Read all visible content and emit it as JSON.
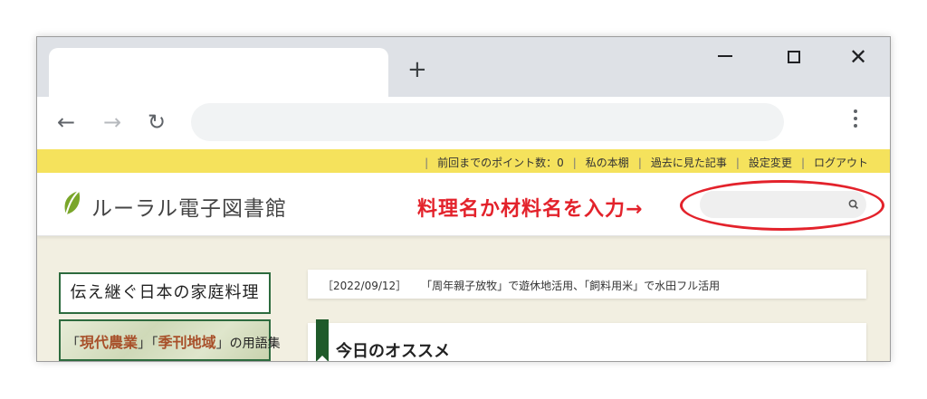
{
  "browser": {
    "new_tab": "+",
    "controls": {
      "close": "✕"
    },
    "nav": {
      "back": "←",
      "forward": "→",
      "reload": "↻"
    },
    "address": {
      "value": ""
    }
  },
  "site": {
    "topnav": {
      "points": "前回までのポイント数：0",
      "bookshelf": "私の本棚",
      "history": "過去に見た記事",
      "settings": "設定変更",
      "logout": "ログアウト"
    },
    "logo": "ルーラル電子図書館",
    "annotation": "料理名か材料名を入力→",
    "search": {
      "value": "",
      "placeholder": ""
    },
    "sidebar": {
      "banner1": "伝え継ぐ日本の家庭料理",
      "banner2": {
        "open1": "「",
        "strong1": "現代農業",
        "close1": "」",
        "open2": "「",
        "strong2": "季刊地域",
        "close2": "」",
        "tail": "の用語集"
      }
    },
    "news": {
      "date": "［2022/09/12］",
      "text": "「周年親子放牧」で遊休地活用、「飼料用米」で水田フル活用"
    },
    "recommend_title": "今日のオススメ"
  },
  "colors": {
    "topbar": "#f5e25c",
    "accent_red": "#e3222b",
    "dark_green": "#1f5a2a",
    "page_bg": "#f2efe1"
  }
}
